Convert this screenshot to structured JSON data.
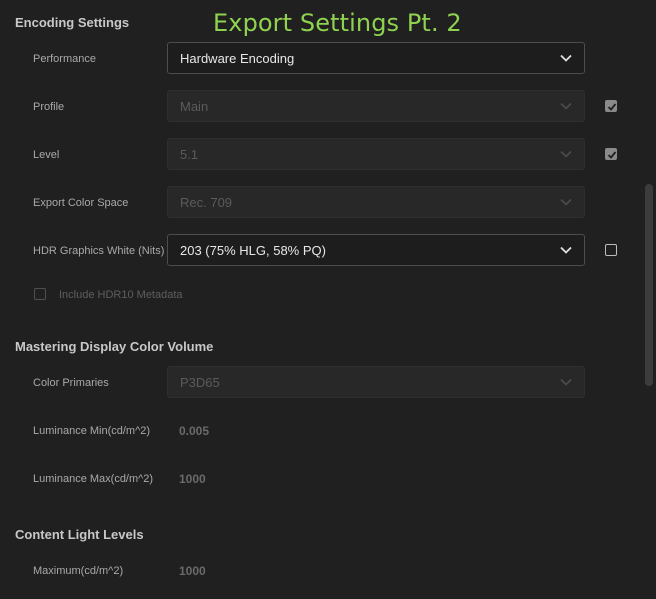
{
  "overlay_title": "Export Settings Pt. 2",
  "encoding": {
    "title": "Encoding Settings",
    "performance": {
      "label": "Performance",
      "value": "Hardware Encoding"
    },
    "profile": {
      "label": "Profile",
      "value": "Main",
      "checkbox_checked": true
    },
    "level": {
      "label": "Level",
      "value": "5.1",
      "checkbox_checked": true
    },
    "export_color_space": {
      "label": "Export Color Space",
      "value": "Rec. 709"
    },
    "hdr_graphics_white": {
      "label": "HDR Graphics White (Nits)",
      "value": "203 (75% HLG, 58% PQ)",
      "checkbox_checked": false
    },
    "include_hdr10": {
      "label": "Include HDR10 Metadata",
      "checked": false
    }
  },
  "mastering": {
    "title": "Mastering Display Color Volume",
    "color_primaries": {
      "label": "Color Primaries",
      "value": "P3D65"
    },
    "luminance_min": {
      "label": "Luminance Min(cd/m^2)",
      "value": "0.005"
    },
    "luminance_max": {
      "label": "Luminance Max(cd/m^2)",
      "value": "1000"
    }
  },
  "content_light": {
    "title": "Content Light Levels",
    "maximum": {
      "label": "Maximum(cd/m^2)",
      "value": "1000"
    }
  },
  "icons": {
    "dropdown": "chevron-down-icon",
    "checkbox": "checkmark-icon"
  },
  "colors": {
    "background": "#202020",
    "overlay_title": "#8fd24f",
    "enabled_text": "#e8e8e8",
    "disabled_text": "#5b5b5b"
  }
}
